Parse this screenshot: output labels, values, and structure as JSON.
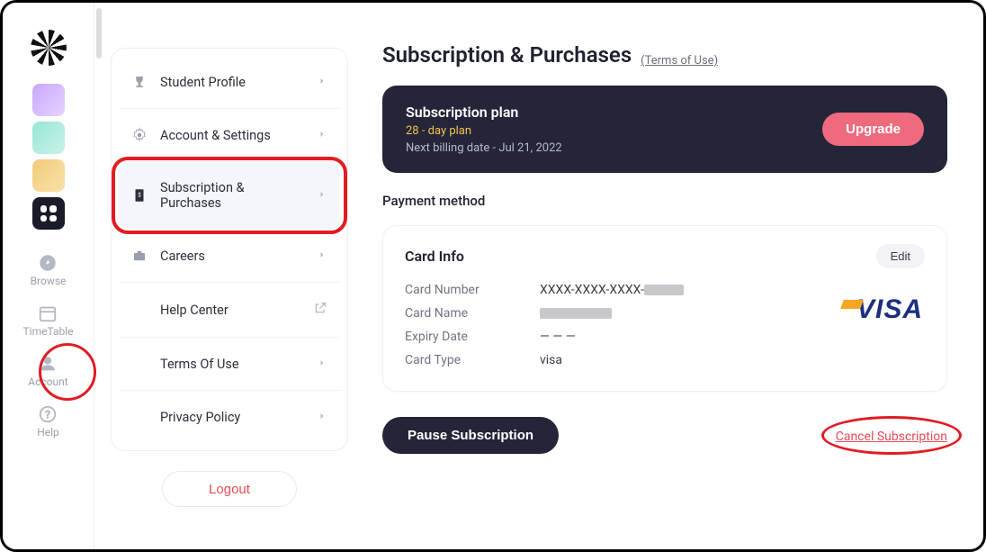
{
  "leftNav": {
    "browse": "Browse",
    "timetable": "TimeTable",
    "account": "Account",
    "help": "Help"
  },
  "menu": {
    "studentProfile": "Student Profile",
    "accountSettings": "Account & Settings",
    "subscription": "Subscription & Purchases",
    "careers": "Careers",
    "helpCenter": "Help Center",
    "terms": "Terms Of Use",
    "privacy": "Privacy Policy",
    "logout": "Logout"
  },
  "page": {
    "title": "Subscription & Purchases",
    "termsLink": "(Terms of Use)"
  },
  "plan": {
    "heading": "Subscription plan",
    "name": "28 - day plan",
    "nextBilling": "Next billing date - Jul 21, 2022",
    "upgrade": "Upgrade"
  },
  "payment": {
    "section": "Payment method",
    "cardInfo": "Card Info",
    "edit": "Edit",
    "labels": {
      "number": "Card Number",
      "name": "Card Name",
      "expiry": "Expiry Date",
      "type": "Card Type"
    },
    "values": {
      "numberPrefix": "XXXX-XXXX-XXXX-",
      "expiry": "— — —",
      "type": "visa"
    },
    "brand": "VISA"
  },
  "actions": {
    "pause": "Pause Subscription",
    "cancel": "Cancel Subscription"
  }
}
